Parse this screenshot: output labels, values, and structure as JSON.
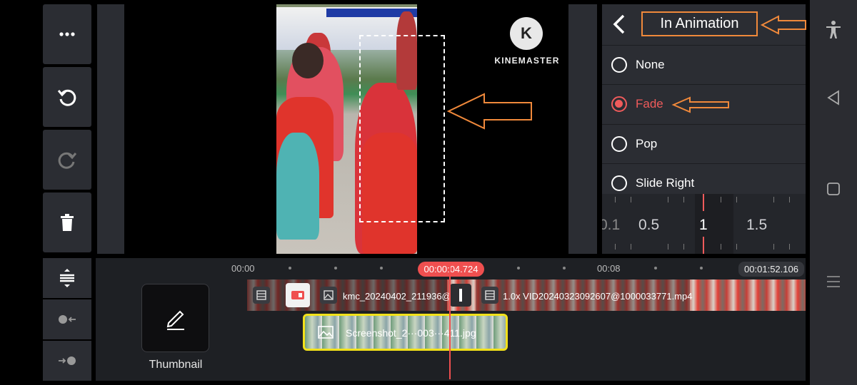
{
  "app": {
    "watermark": "KINEMASTER",
    "logo_letter": "K"
  },
  "toolbar": {
    "items": [
      {
        "name": "more-button",
        "icon": "more-dots-icon"
      },
      {
        "name": "undo-button",
        "icon": "undo-icon"
      },
      {
        "name": "redo-button",
        "icon": "redo-icon"
      },
      {
        "name": "delete-button",
        "icon": "trash-icon"
      }
    ]
  },
  "panel": {
    "title": "In Animation",
    "options": [
      {
        "label": "None",
        "selected": false
      },
      {
        "label": "Fade",
        "selected": true
      },
      {
        "label": "Pop",
        "selected": false
      },
      {
        "label": "Slide Right",
        "selected": false
      }
    ],
    "duration_ruler": {
      "values": [
        "0.1",
        "0.5",
        "1",
        "1.5"
      ],
      "selected": "1"
    },
    "accent_color": "#ef5b5b",
    "annotation_color": "#f0893b"
  },
  "timeline": {
    "time_markers": [
      "00:00",
      "00:04",
      "00:08"
    ],
    "current_time": "00:00:04.724",
    "total_time": "00:01:52.106",
    "thumbnail_label": "Thumbnail",
    "clips": {
      "main_clip_1": "kmc_20240402_211936@",
      "main_clip_2": "1.0x  VID20240323092607@1000033771.mp4",
      "overlay_clip": "Screenshot_2···003···411.jpg"
    },
    "overlay_border_color": "#f2e11a"
  }
}
